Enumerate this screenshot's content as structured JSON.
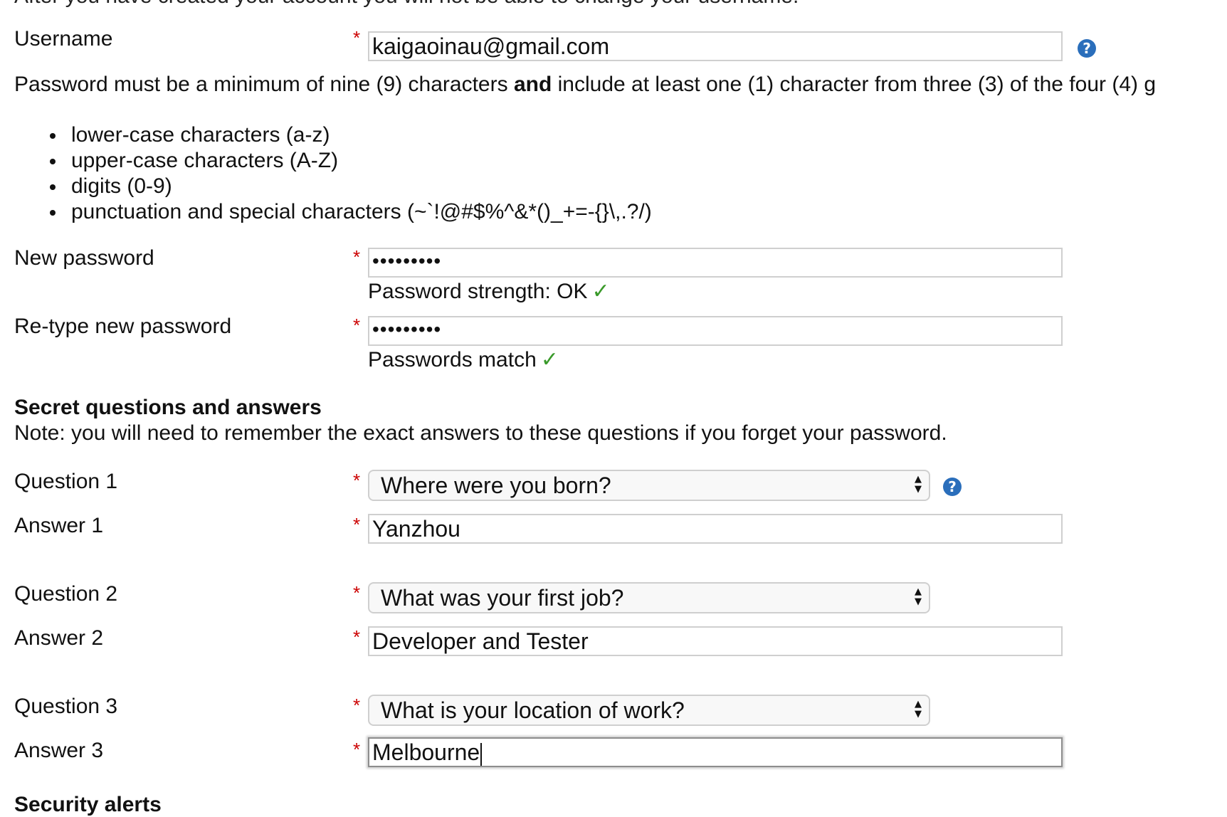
{
  "intro_cut_text": "After you have created your account you will not be able to change your username.",
  "username": {
    "label": "Username",
    "value": "kaigaoinau@gmail.com",
    "help_icon": "question-circle-icon"
  },
  "password_rules": {
    "text_before": "Password must be a minimum of nine (9) characters ",
    "text_bold": "and",
    "text_after": " include at least one (1) character from three (3) of the four (4) g",
    "items": [
      "lower-case characters (a-z)",
      "upper-case characters (A-Z)",
      "digits (0-9)",
      "punctuation and special characters (~`!@#$%^&*()_+=-{}\\,.?/)"
    ]
  },
  "new_password": {
    "label": "New password",
    "value": "•••••••••",
    "strength_text": "Password strength: OK",
    "check": "✓"
  },
  "retype_password": {
    "label": "Re-type new password",
    "value": "•••••••••",
    "match_text": "Passwords match",
    "check": "✓"
  },
  "secret": {
    "heading": "Secret questions and answers",
    "note": "Note: you will need to remember the exact answers to these questions if you forget your password.",
    "q1_label": "Question 1",
    "q1_value": "Where were you born?",
    "a1_label": "Answer 1",
    "a1_value": "Yanzhou",
    "q2_label": "Question 2",
    "q2_value": "What was your first job?",
    "a2_label": "Answer 2",
    "a2_value": "Developer and Tester",
    "q3_label": "Question 3",
    "q3_value": "What is your location of work?",
    "a3_label": "Answer 3",
    "a3_value": "Melbourne"
  },
  "security_alerts_heading": "Security alerts",
  "required_marker": "*",
  "help_glyph": "?",
  "select_arrows": "▲▼",
  "colors": {
    "required": "#cc0000",
    "help_icon": "#2a6ebb",
    "check": "#3a9a2a"
  }
}
